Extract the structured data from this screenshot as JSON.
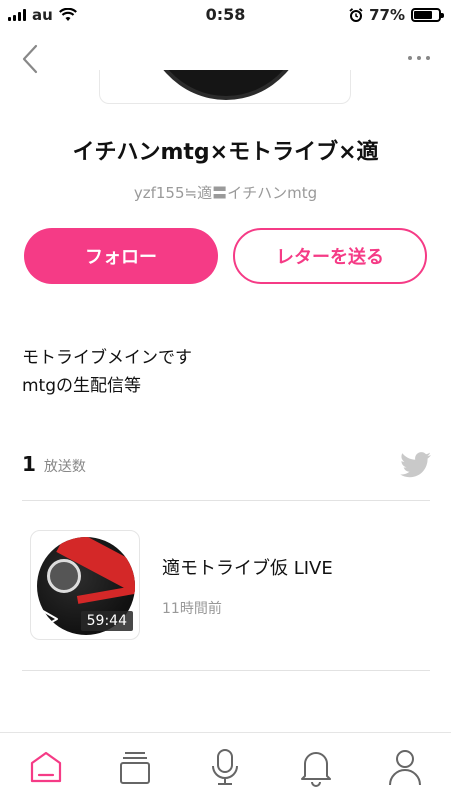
{
  "status": {
    "carrier": "au",
    "time": "0:58",
    "battery": "77%"
  },
  "profile": {
    "name": "イチハンmtg×モトライブ×適",
    "subtitle": "yzf155≒適〓イチハンmtg",
    "bio_line1": "モトライブメインです",
    "bio_line2": "mtgの生配信等"
  },
  "actions": {
    "follow": "フォロー",
    "letter": "レターを送る"
  },
  "stats": {
    "count": "1",
    "label": "放送数"
  },
  "broadcasts": [
    {
      "title": "適モトライブ仮 LIVE",
      "time_ago": "11時間前",
      "duration": "59:44"
    }
  ],
  "colors": {
    "accent": "#f53b86",
    "tab_inactive": "#666666"
  },
  "tabs": [
    "home-icon",
    "cards-icon",
    "mic-icon",
    "bell-icon",
    "person-icon"
  ]
}
